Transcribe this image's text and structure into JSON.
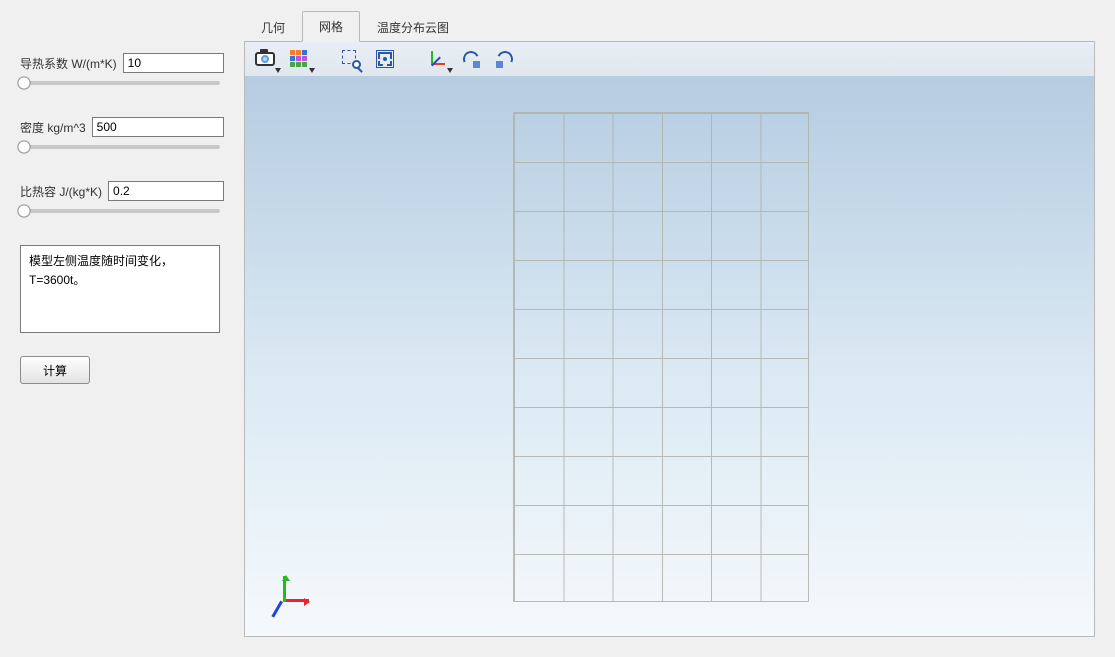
{
  "sidebar": {
    "param1": {
      "label": "导热系数 W/(m*K)",
      "value": "10"
    },
    "param2": {
      "label": "密度 kg/m^3",
      "value": "500"
    },
    "param3": {
      "label": "比热容 J/(kg*K)",
      "value": "0.2"
    },
    "description": "模型左侧温度随时间变化，T=3600t。",
    "calc_label": "计算"
  },
  "tabs": {
    "t1": "几何",
    "t2": "网格",
    "t3": "温度分布云图",
    "active": "t2"
  },
  "toolbar_icons": [
    "camera-icon",
    "options-icon",
    "zoom-region-icon",
    "fit-view-icon",
    "axes-icon",
    "rotate-ccw-icon",
    "rotate-cw-icon"
  ]
}
